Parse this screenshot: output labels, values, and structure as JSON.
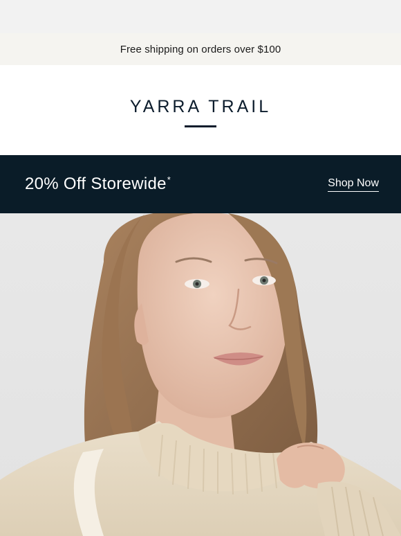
{
  "promo": {
    "text": "Free shipping on orders over $100"
  },
  "brand": {
    "name": "YARRA TRAIL"
  },
  "sale": {
    "title": "20% Off Storewide",
    "marker": "*",
    "cta": "Shop Now"
  },
  "colors": {
    "navy": "#0a1c28",
    "strip": "#f5f4f0",
    "page_bg": "#f2f2f2",
    "hero_bg": "#e4e4e4",
    "sweater": "#e9dcc6"
  }
}
